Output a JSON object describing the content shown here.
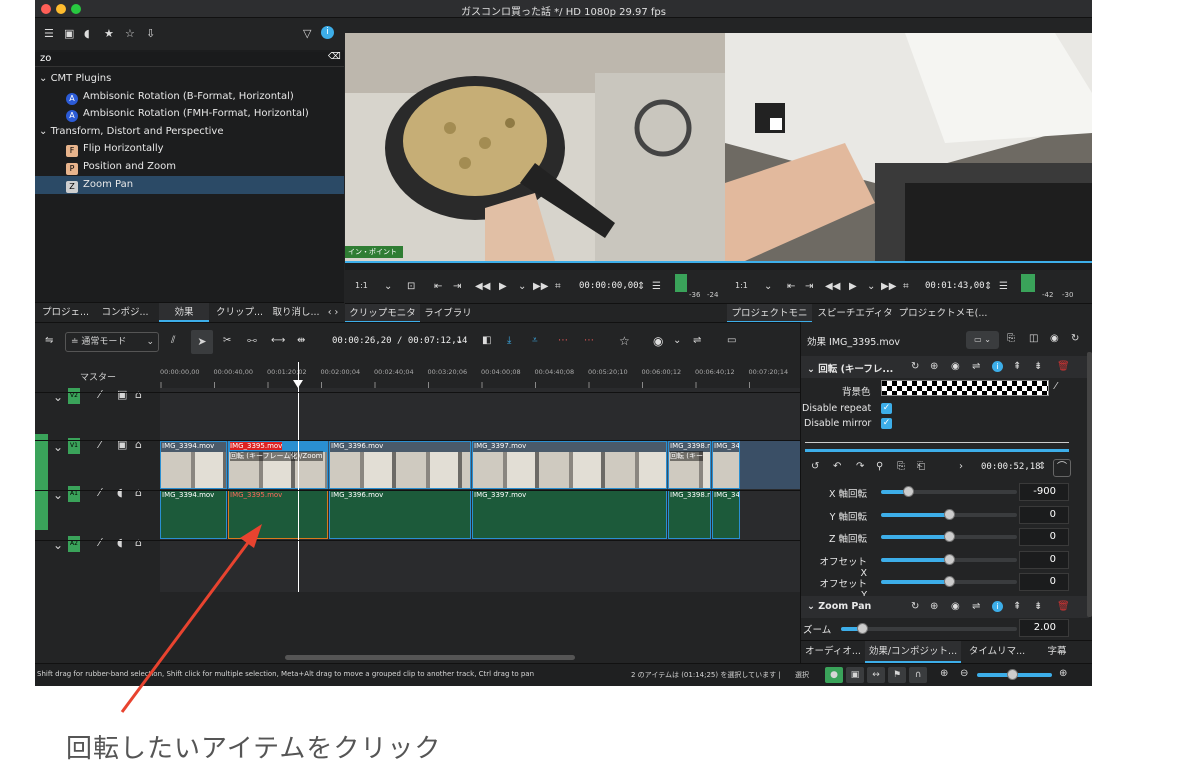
{
  "window": {
    "title": "ガスコンロ買った話 */ HD 1080p 29.97 fps"
  },
  "effects": {
    "search_value": "zo",
    "tree": [
      {
        "label": "CMT Plugins",
        "type": "group"
      },
      {
        "label": "Ambisonic Rotation (B-Format, Horizontal)",
        "badge": "A",
        "type": "item"
      },
      {
        "label": "Ambisonic Rotation (FMH-Format, Horizontal)",
        "badge": "A",
        "type": "item"
      },
      {
        "label": "Transform, Distort and Perspective",
        "type": "group"
      },
      {
        "label": "Flip Horizontally",
        "badge": "F",
        "type": "item"
      },
      {
        "label": "Position and Zoom",
        "badge": "P",
        "type": "item"
      },
      {
        "label": "Zoom Pan",
        "badge": "Z",
        "type": "item",
        "selected": true
      }
    ],
    "tabs": [
      "プロジェ...",
      "コンポジ...",
      "効果",
      "クリップ...",
      "取り消し..."
    ]
  },
  "clip_monitor": {
    "in_point_label": "イン・ポイント",
    "zoom": "1:1",
    "timecode": "00:00:00,00",
    "audio_scale": [
      "-36",
      "-24"
    ],
    "tabs": [
      "クリップモニタ",
      "ライブラリ"
    ]
  },
  "project_monitor": {
    "zoom": "1:1",
    "timecode": "00:01:43,00",
    "audio_scale": [
      "-42",
      "-30"
    ],
    "tabs": [
      "プロジェクトモニタ",
      "スピーチエディタ",
      "プロジェクトメモ(..."
    ]
  },
  "timeline": {
    "mode": "通常モード",
    "position": "00:00:26,20 / 00:07:12,14",
    "master_label": "マスター",
    "ruler": [
      "00:00:00,00",
      "00:00:40,00",
      "00:01:20;02",
      "00:02:00;04",
      "00:02:40;04",
      "00:03:20;06",
      "00:04:00;08",
      "00:04:40;08",
      "00:05:20;10",
      "00:06:00;12",
      "00:06:40;12",
      "00:07:20;14"
    ],
    "tracks": [
      "V2",
      "V1",
      "A1",
      "A2"
    ],
    "video_clips": [
      {
        "name": "IMG_3394.mov"
      },
      {
        "name": "IMG_3395.mov",
        "effect": "回転 (キーフレーム化)/Zoom"
      },
      {
        "name": "IMG_3396.mov"
      },
      {
        "name": "IMG_3397.mov"
      },
      {
        "name": "IMG_3398.m",
        "effect": "回転 (キー"
      },
      {
        "name": "IMG_34"
      }
    ],
    "audio_clips": [
      "IMG_3394.mov",
      "IMG_3395.mov",
      "IMG_3396.mov",
      "IMG_3397.mov",
      "IMG_3398.m",
      "IMG_34"
    ]
  },
  "properties": {
    "title": "効果 IMG_3395.mov",
    "effect1": "回転 (キーフレ...",
    "bg_label": "背景色",
    "disable_repeat": "Disable repeat",
    "disable_mirror": "Disable mirror",
    "keyframe_time": "00:00:52,18",
    "params": [
      {
        "label": "X 軸回転",
        "value": "-900",
        "level": 0.2
      },
      {
        "label": "Y 軸回転",
        "value": "0",
        "level": 0.5
      },
      {
        "label": "Z 軸回転",
        "value": "0",
        "level": 0.5
      },
      {
        "label": "オフセット X",
        "value": "0",
        "level": 0.5
      },
      {
        "label": "オフセット Y",
        "value": "0",
        "level": 0.5
      }
    ],
    "effect2": "Zoom Pan",
    "zoom_label": "ズーム",
    "zoom_value": "2.00",
    "tabs": [
      "オーディオ...",
      "効果/コンポジット...",
      "タイムリマ...",
      "字幕"
    ]
  },
  "status": {
    "hint": "Shift drag for rubber-band selection, Shift click for multiple selection, Meta+Alt drag to move a grouped clip to another track, Ctrl drag to pan",
    "selection": "2 のアイテムは (01:14;25) を選択しています |",
    "select_label": "選択"
  },
  "annotation": {
    "caption": "回転したいアイテムをクリック"
  },
  "colors": {
    "accent": "#3daee9",
    "track_label": "#3aa35a",
    "clip_border": "#2a8fd1",
    "arrow": "#e8432f"
  }
}
